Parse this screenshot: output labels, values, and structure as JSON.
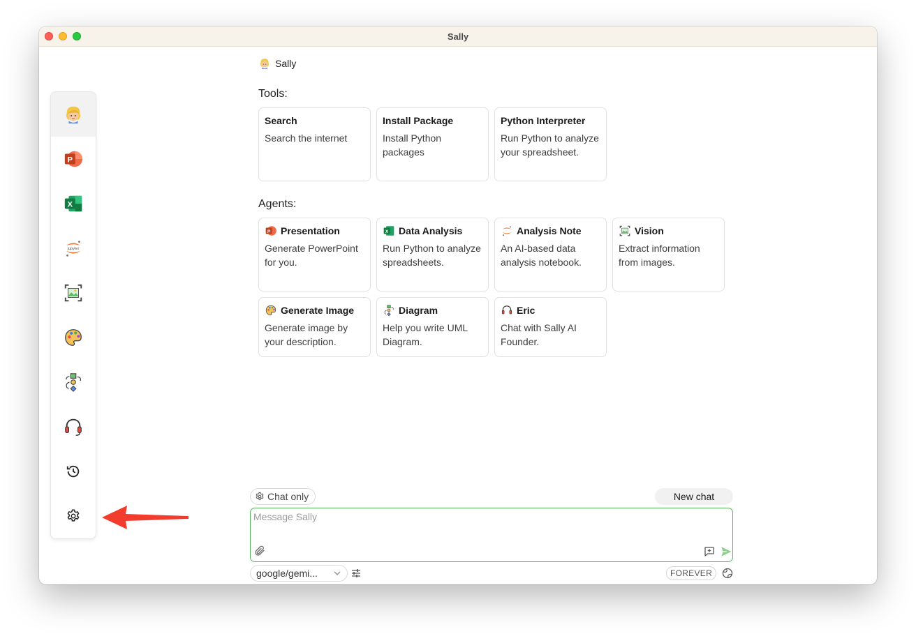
{
  "window": {
    "title": "Sally"
  },
  "sidebar": {
    "items": [
      {
        "name": "sally",
        "icon": "sally-face-icon",
        "active": true
      },
      {
        "name": "presentation",
        "icon": "powerpoint-icon"
      },
      {
        "name": "data-analysis",
        "icon": "excel-icon"
      },
      {
        "name": "analysis-note",
        "icon": "jupyter-icon"
      },
      {
        "name": "vision",
        "icon": "vision-scan-icon"
      },
      {
        "name": "generate-image",
        "icon": "palette-icon"
      },
      {
        "name": "diagram",
        "icon": "diagram-icon"
      },
      {
        "name": "eric",
        "icon": "headset-icon"
      },
      {
        "name": "history",
        "icon": "history-icon"
      },
      {
        "name": "settings",
        "icon": "gear-icon"
      }
    ]
  },
  "agent": {
    "name": "Sally"
  },
  "tools": {
    "label": "Tools:",
    "cards": [
      {
        "title": "Search",
        "desc": "Search the internet"
      },
      {
        "title": "Install Package",
        "desc": "Install Python packages"
      },
      {
        "title": "Python Interpreter",
        "desc": "Run Python to analyze your spreadsheet."
      }
    ]
  },
  "agents": {
    "label": "Agents:",
    "cards": [
      {
        "title": "Presentation",
        "desc": "Generate PowerPoint for you.",
        "icon": "powerpoint-icon"
      },
      {
        "title": "Data Analysis",
        "desc": "Run Python to analyze spreadsheets.",
        "icon": "excel-icon"
      },
      {
        "title": "Analysis Note",
        "desc": "An AI-based data analysis notebook.",
        "icon": "jupyter-icon"
      },
      {
        "title": "Vision",
        "desc": "Extract information from images.",
        "icon": "vision-scan-icon"
      },
      {
        "title": "Generate Image",
        "desc": "Generate image by your description.",
        "icon": "palette-icon"
      },
      {
        "title": "Diagram",
        "desc": "Help you write UML Diagram.",
        "icon": "diagram-icon"
      },
      {
        "title": "Eric",
        "desc": "Chat with Sally AI Founder.",
        "icon": "headset-icon"
      }
    ]
  },
  "chat": {
    "chat_only_label": "Chat only",
    "new_chat_label": "New chat",
    "message_placeholder": "Message Sally",
    "model_value": "google/gemi...",
    "forever_label": "FOREVER"
  },
  "colors": {
    "accent_green": "#59b35a",
    "annotation_arrow": "#f23d2e"
  }
}
